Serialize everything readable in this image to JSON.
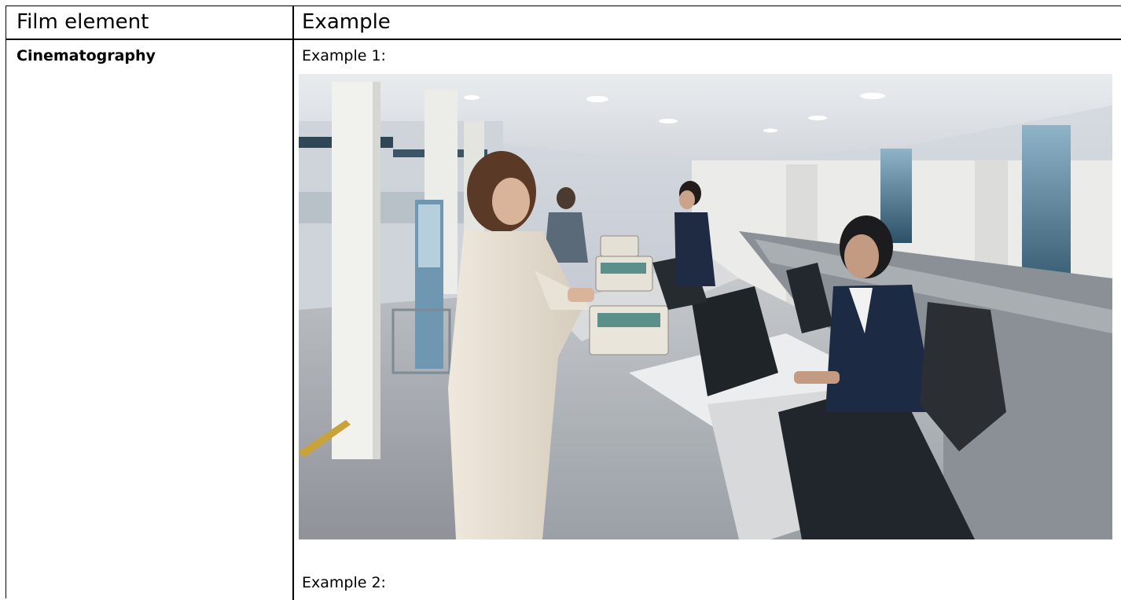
{
  "table": {
    "headers": {
      "col1": "Film element",
      "col2": "Example"
    },
    "row1": {
      "element": "Cinematography",
      "example1_label": "Example 1:",
      "example2_label": "Example 2:"
    }
  },
  "photo": {
    "subject": "airport-check-in-counter-scene"
  }
}
